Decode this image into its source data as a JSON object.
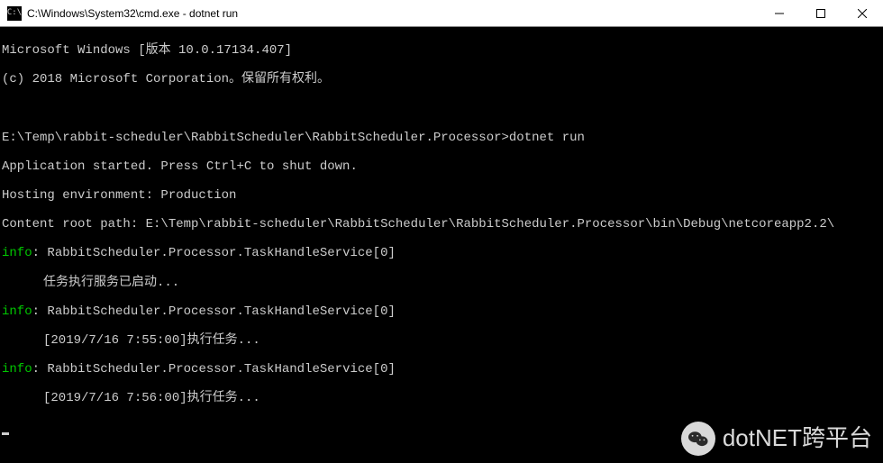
{
  "titlebar": {
    "title": "C:\\Windows\\System32\\cmd.exe - dotnet  run"
  },
  "terminal": {
    "header1": "Microsoft Windows [版本 10.0.17134.407]",
    "header2": "(c) 2018 Microsoft Corporation。保留所有权利。",
    "prompt": "E:\\Temp\\rabbit-scheduler\\RabbitScheduler\\RabbitScheduler.Processor>",
    "command": "dotnet run",
    "app_started": "Application started. Press Ctrl+C to shut down.",
    "hosting_env": "Hosting environment: Production",
    "content_root": "Content root path: E:\\Temp\\rabbit-scheduler\\RabbitScheduler\\RabbitScheduler.Processor\\bin\\Debug\\netcoreapp2.2\\",
    "log_label": "info",
    "log_source": ": RabbitScheduler.Processor.TaskHandleService[0]",
    "log1_msg": "任务执行服务已启动...",
    "log2_msg": "[2019/7/16 7:55:00]执行任务...",
    "log3_msg": "[2019/7/16 7:56:00]执行任务..."
  },
  "watermark": {
    "text": "dotNET跨平台"
  }
}
